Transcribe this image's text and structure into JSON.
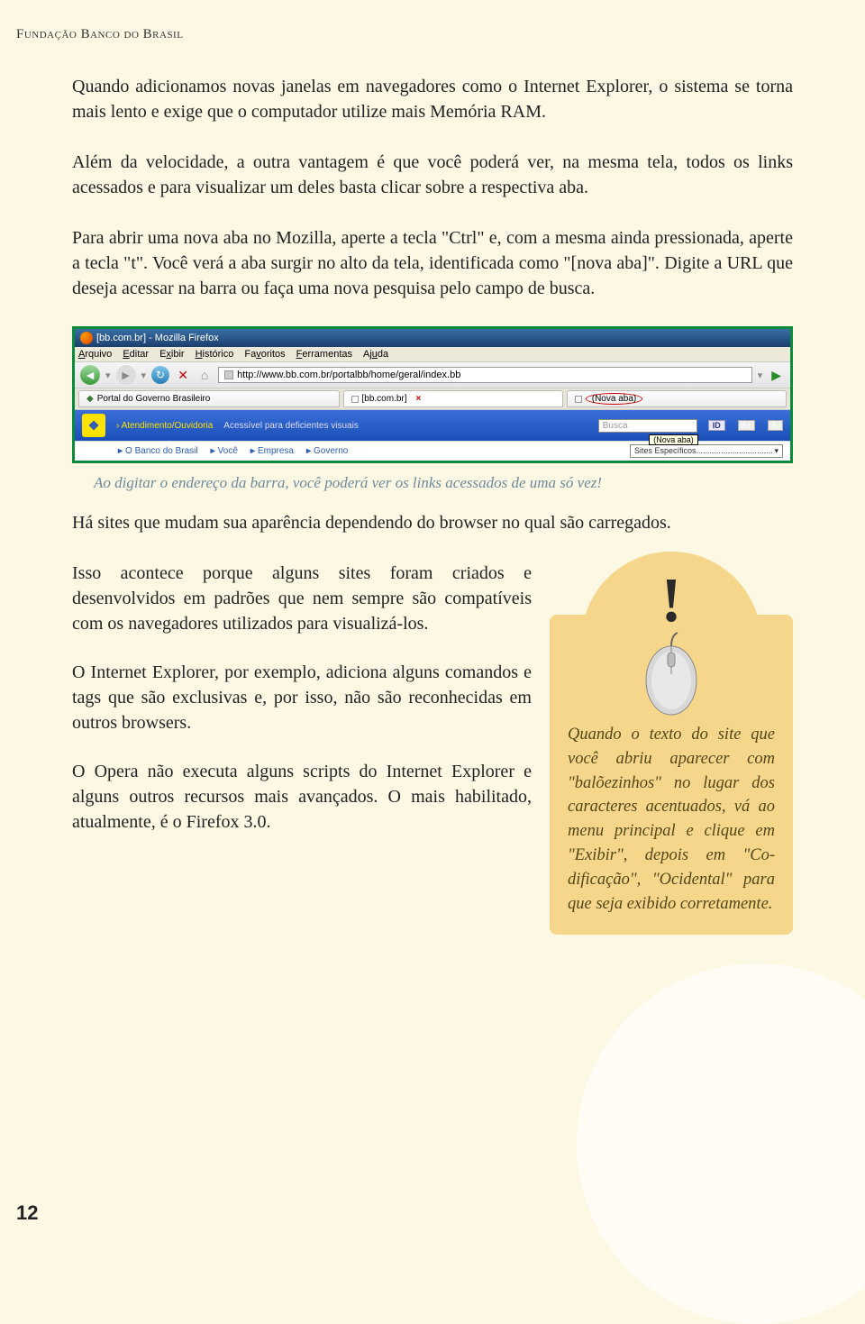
{
  "header": "Fundação Banco do Brasil",
  "p1": "Quando adicionamos novas janelas em navegadores como o Internet Explo­rer, o sistema se torna mais lento e exige que o computador utilize mais Me­mória RAM.",
  "p2": "Além da velocidade, a outra vantagem é que você poderá ver, na mesma tela, todos os links acessados e para visualizar um deles basta clicar sobre a res­pectiva aba.",
  "p3": "Para abrir uma nova aba no Mozilla, aperte a tecla \"Ctrl\" e, com a mesma ainda pressionada, aperte a tecla \"t\". Você verá a aba surgir no alto da tela, identificada como \"[nova aba]\". Digite a URL que deseja acessar na barra ou faça uma nova pesquisa pelo campo de busca.",
  "browser": {
    "title": "[bb.com.br] - Mozilla Firefox",
    "menu": {
      "arquivo": "Arquivo",
      "editar": "Editar",
      "exibir": "Exibir",
      "historico": "Histórico",
      "favoritos": "Favoritos",
      "ferramentas": "Ferramentas",
      "ajuda": "Ajuda"
    },
    "url": "http://www.bb.com.br/portalbb/home/geral/index.bb",
    "tabs": {
      "t1": "Portal do Governo Brasileiro",
      "t2": "[bb.com.br]",
      "t3": "(Nova aba)"
    },
    "strip": {
      "atend": "Atendimento/Ouvidoria",
      "acess": "Acessível para deficientes visuais",
      "busca": "Busca",
      "tooltip": "(Nova aba)",
      "id": "ID",
      "ap": "A+",
      "am": "A-"
    },
    "nav2": {
      "banco": "O Banco do Brasil",
      "voce": "Você",
      "empresa": "Empresa",
      "governo": "Governo",
      "sites": "Sites Específicos.................................."
    }
  },
  "caption": "Ao digitar o endereço da barra, você poderá ver os links acessados de uma só vez!",
  "p4": "Há sites que mudam sua aparência dependendo do browser no qual são car­regados.",
  "p5": "Isso acontece porque alguns sites foram cria­dos e desenvolvidos em padrões que nem sem­pre são compatíveis com os navegadores utili­zados para visualizá-los.",
  "p6": "O Internet Explorer, por exemplo, adiciona alguns comandos e tags que são exclusivas e, por isso, não são reconhecidas em outros bro­wsers.",
  "p7": "O Opera não executa alguns scripts do Inter­net Explorer e alguns outros recursos mais avançados. O mais habilitado, atualmente, é o Firefox 3.0.",
  "sidebar": "Quando o texto do site que você abriu apare­cer com \"balõezinhos\" no lugar dos caracteres acentuados, vá ao menu principal e clique em \"Exibir\", depois em \"Co­dificação\", \"Ocidental\" para que seja exibido corretamente.",
  "page": "12"
}
